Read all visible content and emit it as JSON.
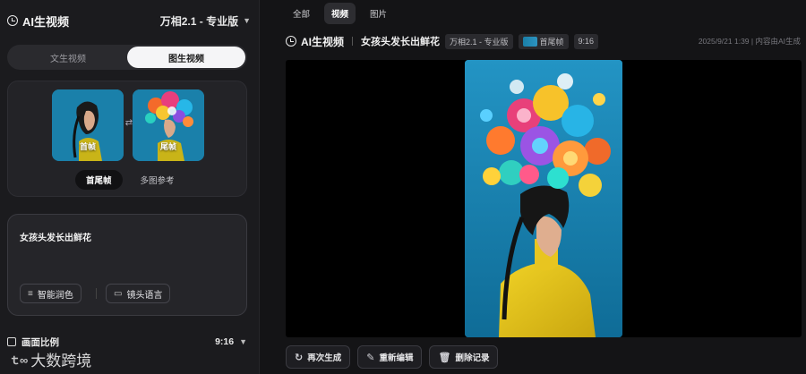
{
  "left": {
    "brand": "AI生视频",
    "model": "万相2.1 - 专业版",
    "mode_tabs": [
      {
        "label": "文生视频",
        "active": false
      },
      {
        "label": "图生视频",
        "active": true
      }
    ],
    "frames": {
      "first_label": "首帧",
      "last_label": "尾帧",
      "tabs": [
        {
          "label": "首尾帧",
          "active": true
        },
        {
          "label": "多图参考",
          "active": false
        }
      ]
    },
    "prompt": {
      "text": "女孩头发长出鲜花",
      "polish_button": "智能润色",
      "camera_button": "镜头语言"
    },
    "aspect": {
      "label": "画面比例",
      "value": "9:16"
    },
    "watermark": "大数跨境"
  },
  "right": {
    "tabs": [
      {
        "label": "全部",
        "active": false
      },
      {
        "label": "视频",
        "active": true
      },
      {
        "label": "图片",
        "active": false
      }
    ],
    "info": {
      "brand": "AI生视频",
      "title": "女孩头发长出鲜花",
      "model_chip": "万相2.1 - 专业版",
      "frames_chip": "首尾帧",
      "ratio_chip": "9:16",
      "meta": "2025/9/21 1:39 | 内容由AI生成"
    },
    "actions": {
      "regenerate": "再次生成",
      "reedit": "重新编辑",
      "delete": "删除记录"
    }
  },
  "colors": {
    "bg": "#141416",
    "panel": "#1b1b1e",
    "card": "#232327",
    "accent_blue": "#1580b0",
    "dress_yellow": "#e3c21b"
  }
}
